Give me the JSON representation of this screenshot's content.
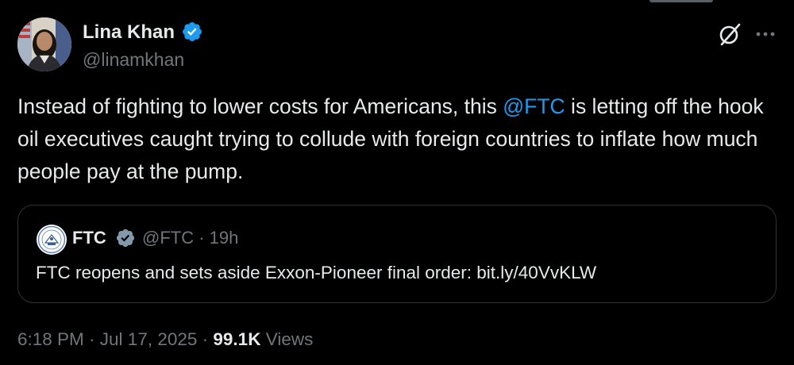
{
  "tweet": {
    "author": {
      "name": "Lina Khan",
      "handle": "@linamkhan"
    },
    "text_before_mention": "Instead of fighting to lower costs for Americans, this ",
    "mention": "@FTC",
    "text_after_mention": " is letting off the hook oil executives caught trying to collude with foreign countries to inflate how much people pay at the pump.",
    "time": "6:18 PM",
    "date": "Jul 17, 2025",
    "views_count": "99.1K",
    "views_label": "Views"
  },
  "quoted_tweet": {
    "name": "FTC",
    "handle": "@FTC",
    "age": "19h",
    "text": "FTC reopens and sets aside Exxon-Pioneer final order: bit.ly/40VvKLW"
  },
  "colors": {
    "background": "#000000",
    "text_primary": "#e7e9ea",
    "text_secondary": "#71767b",
    "accent_blue": "#1d9bf0",
    "border": "#2f3336",
    "verified_badge": "#1d9bf0",
    "gov_badge": "#829aab"
  },
  "icons": {
    "verified": "verified-check-icon",
    "government": "gray-verified-check-icon",
    "grok": "grok-icon",
    "more": "more-dots-icon"
  }
}
